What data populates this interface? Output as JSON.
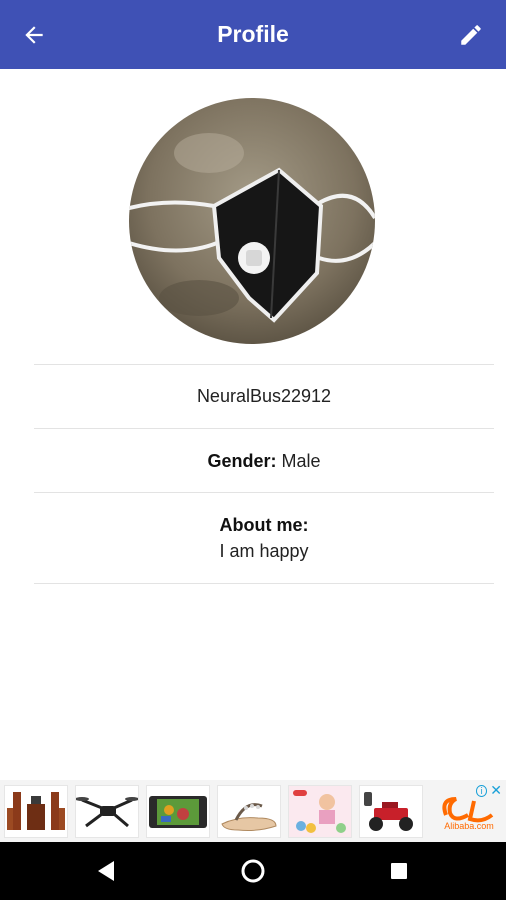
{
  "header": {
    "title": "Profile",
    "back_icon": "arrow-back-icon",
    "edit_icon": "pencil-edit-icon",
    "background": "#3f51b5"
  },
  "profile": {
    "username": "NeuralBus22912",
    "gender_label": "Gender:",
    "gender_value": "Male",
    "about_label": "About me:",
    "about_value": "I am happy"
  },
  "ad": {
    "items": [
      "speaker-system",
      "drone",
      "game-tablet",
      "sandal",
      "kids-toys",
      "rc-car",
      "alibaba-logo"
    ],
    "alibaba_text": "Alibaba.com",
    "info_icon": "info-icon",
    "close_icon": "close-icon"
  },
  "navbar": {
    "back": "triangle-back-icon",
    "home": "circle-home-icon",
    "recents": "square-recents-icon"
  }
}
